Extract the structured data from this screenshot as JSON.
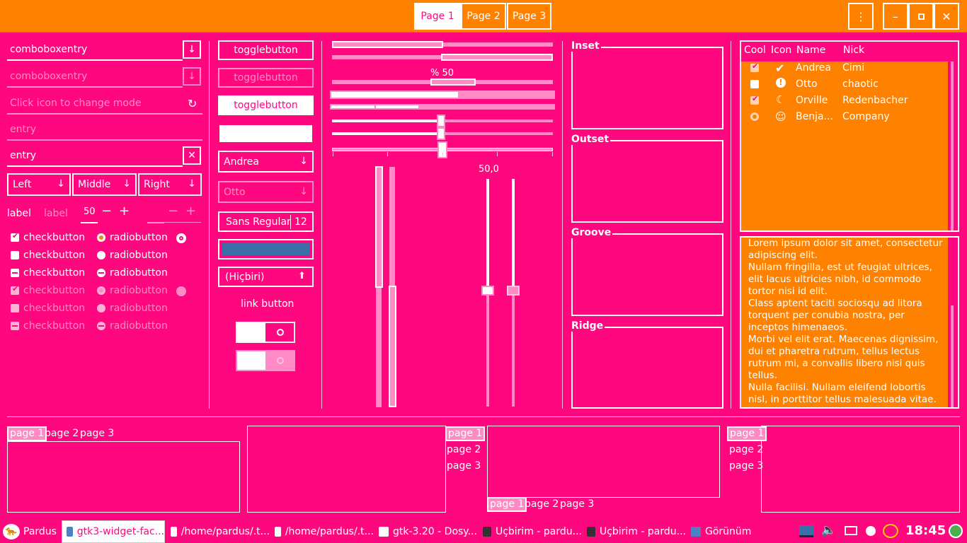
{
  "window": {
    "tabs": [
      "Page 1",
      "Page 2",
      "Page 3"
    ],
    "menu_icon": "kebab-menu-icon",
    "minimize_icon": "minimize-icon",
    "maximize_icon": "maximize-icon",
    "close_icon": "close-icon"
  },
  "col1": {
    "combo1": "comboboxentry",
    "combo2": "comboboxentry",
    "entry_mode_placeholder": "Click icon to change mode",
    "entry_placeholder": "entry",
    "entry_value": "entry",
    "combos": [
      "Left",
      "Middle",
      "Right"
    ],
    "label": "label",
    "label_dim": "label",
    "spin_value": "50",
    "checks": [
      "checkbutton",
      "checkbutton",
      "checkbutton",
      "checkbutton",
      "checkbutton",
      "checkbutton"
    ],
    "radios": [
      "radiobutton",
      "radiobutton",
      "radiobutton",
      "radiobutton",
      "radiobutton",
      "radiobutton"
    ]
  },
  "col2": {
    "toggle1": "togglebutton",
    "toggle2": "togglebutton",
    "toggle3": "togglebutton",
    "combo_andrea": "Andrea",
    "combo_otto": "Otto",
    "font_name": "Sans Regular",
    "font_size": "12",
    "color": "#3a6fa8",
    "file": "(Hiçbiri)",
    "link": "link button"
  },
  "col3": {
    "progress_label": "% 50",
    "progress1": 0.57,
    "scale_value": "50,0"
  },
  "frames": {
    "inset": "Inset",
    "outset": "Outset",
    "groove": "Groove",
    "ridge": "Ridge"
  },
  "tree": {
    "headers": [
      "Cool",
      "Icon",
      "Name",
      "Nick"
    ],
    "rows": [
      {
        "name": "Andrea",
        "nick": "Cimi"
      },
      {
        "name": "Otto",
        "nick": "chaotic"
      },
      {
        "name": "Orville",
        "nick": "Redenbacher"
      },
      {
        "name": "Benja...",
        "nick": "Company"
      }
    ]
  },
  "textview": [
    "Lorem ipsum dolor sit amet, consectetur",
    "adipiscing elit.",
    "Nullam fringilla, est ut feugiat ultrices,",
    "elit lacus ultricies nibh, id commodo",
    "tortor nisi id elit.",
    "Class aptent taciti sociosqu ad litora",
    "torquent per conubia nostra, per",
    "inceptos himenaeos.",
    "Morbi vel elit erat. Maecenas dignissim,",
    "dui et pharetra rutrum, tellus lectus",
    "rutrum mi, a convallis libero nisi quis",
    "tellus.",
    "Nulla facilisi. Nullam eleifend lobortis",
    "nisl, in porttitor tellus malesuada vitae."
  ],
  "notebooks": {
    "tabs": [
      "page 1",
      "page 2",
      "page 3"
    ]
  },
  "taskbar": {
    "start": "Pardus",
    "items": [
      "gtk3-widget-fac...",
      "/home/pardus/.t...",
      "/home/pardus/.t...",
      "gtk-3.20 - Dosy...",
      "Uçbirim - pardu...",
      "Uçbirim - pardu...",
      "Görünüm"
    ],
    "clock": "18:45"
  },
  "colors": {
    "background": "#ff087f",
    "header": "#ff8100",
    "accent_light": "#ff8ac5"
  }
}
